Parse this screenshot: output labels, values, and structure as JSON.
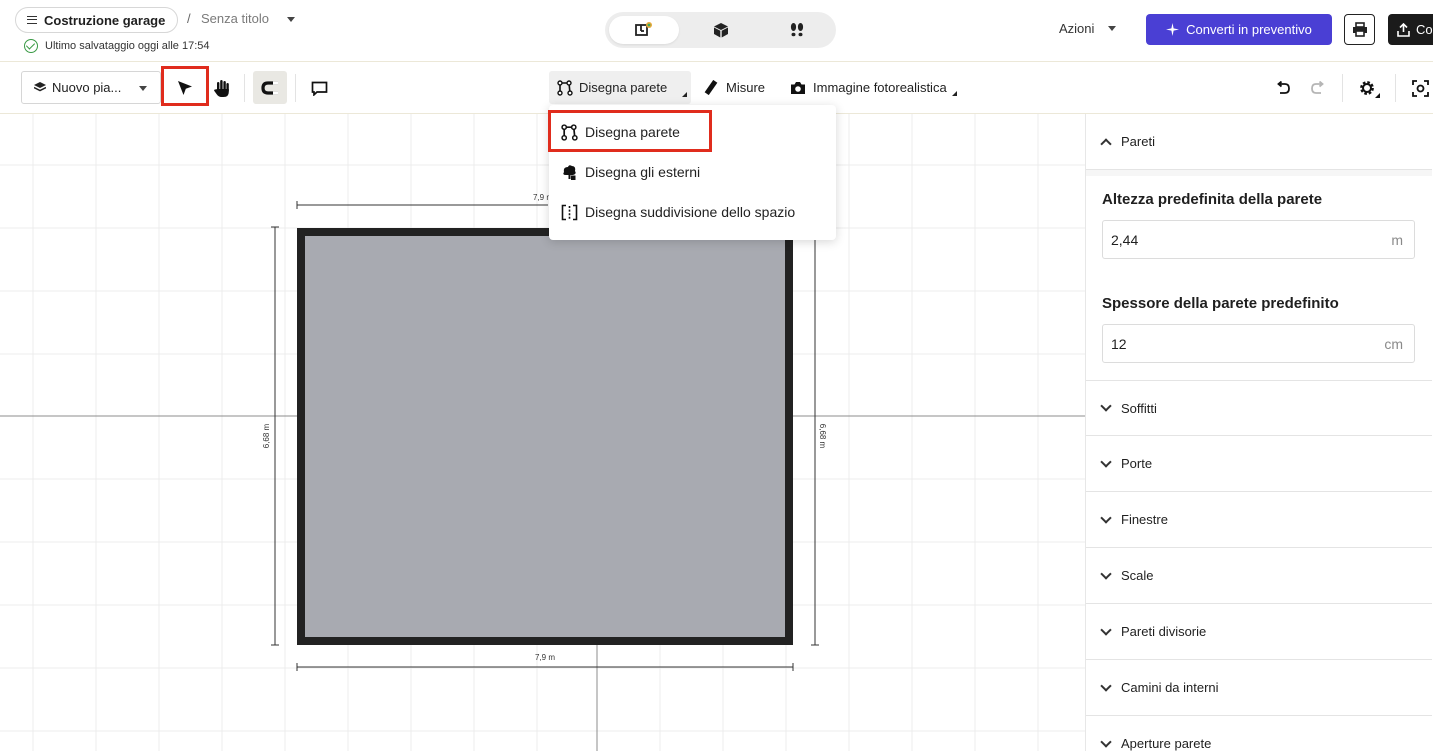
{
  "header": {
    "project_name": "Costruzione garage",
    "separator": "/",
    "document_title": "Senza titolo",
    "save_status": "Ultimo salvataggio oggi alle 17:54",
    "actions_label": "Azioni",
    "convert_label": "Converti in preventivo",
    "share_label": "Co",
    "view_modes": [
      "2d-plan-icon",
      "3d-box-icon",
      "walkthrough-icon"
    ]
  },
  "toolbar": {
    "floor_label": "Nuovo pia...",
    "draw_wall_label": "Disegna parete",
    "measures_label": "Misure",
    "photo_label": "Immagine fotorealistica"
  },
  "dropdown": {
    "items": [
      {
        "label": "Disegna parete",
        "icon": "wall-draw-icon"
      },
      {
        "label": "Disegna gli esterni",
        "icon": "exterior-icon"
      },
      {
        "label": "Disegna suddivisione dello spazio",
        "icon": "space-division-icon"
      }
    ]
  },
  "canvas": {
    "width_label": "7,9 m",
    "height_label": "6,68 m"
  },
  "panel": {
    "walls_title": "Pareti",
    "default_height_label": "Altezza predefinita della parete",
    "default_height_value": "2,44",
    "default_height_unit": "m",
    "default_thickness_label": "Spessore della parete predefinito",
    "default_thickness_value": "12",
    "default_thickness_unit": "cm",
    "sections": [
      "Soffitti",
      "Porte",
      "Finestre",
      "Scale",
      "Pareti divisorie",
      "Camini da interni",
      "Aperture parete"
    ]
  },
  "colors": {
    "accent": "#4a3fd4",
    "highlight": "#e02c1d",
    "room_fill": "#a8aab1",
    "wall": "#222222",
    "grid": "#ececec"
  }
}
